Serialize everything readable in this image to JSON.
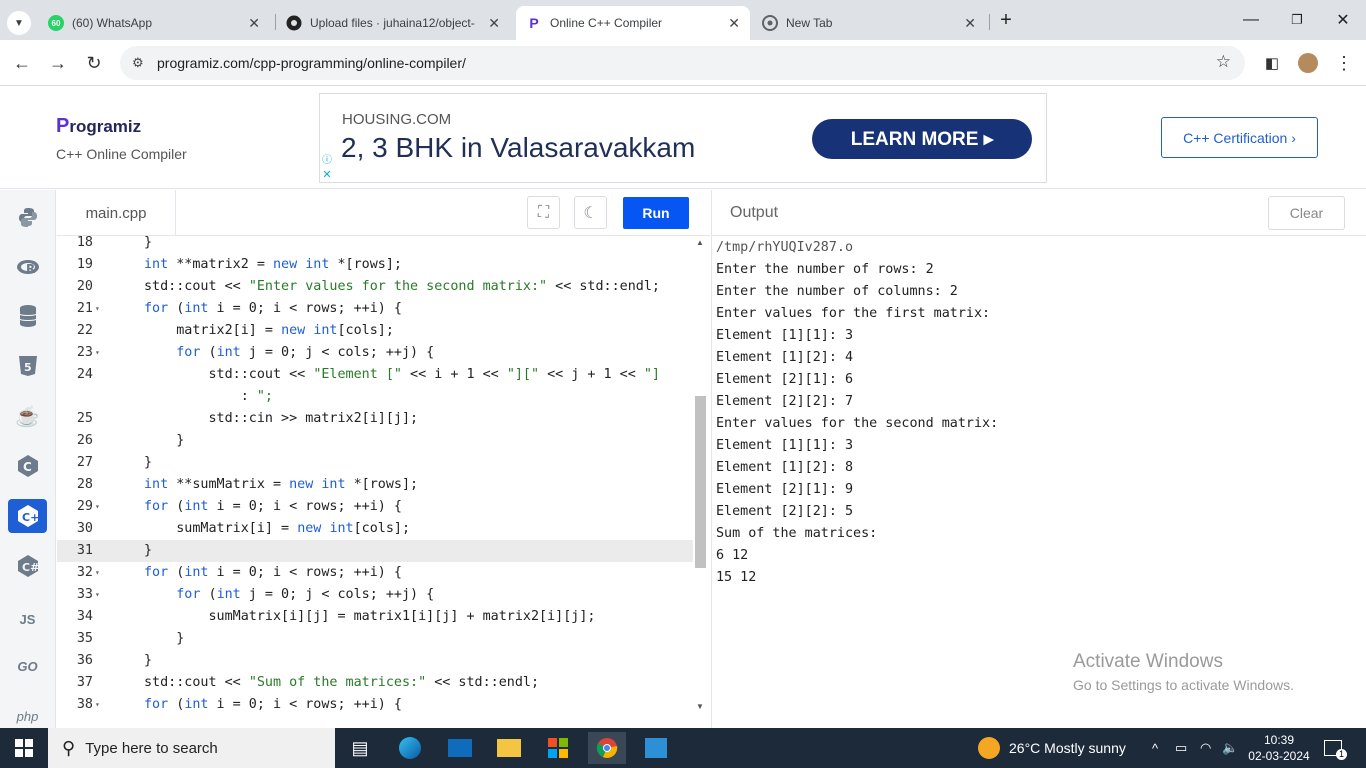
{
  "browser": {
    "tabs": [
      {
        "title": "(60) WhatsApp",
        "badge": "60"
      },
      {
        "title": "Upload files · juhaina12/object-"
      },
      {
        "title": "Online C++ Compiler"
      },
      {
        "title": "New Tab"
      }
    ],
    "url": "programiz.com/cpp-programming/online-compiler/"
  },
  "site": {
    "logo": "rogramiz",
    "logo_p": "P",
    "subtitle": "C++ Online Compiler",
    "ad": {
      "brand": "HOUSING.COM",
      "headline": "2, 3 BHK in Valasaravakkam",
      "cta": "LEARN MORE ▸"
    },
    "cert_button": "C++ Certification ›"
  },
  "rail": [
    "python",
    "r",
    "sql",
    "html5",
    "java",
    "c",
    "cpp",
    "csharp",
    "JS",
    "GO",
    "php"
  ],
  "editor": {
    "file_tab": "main.cpp",
    "run_label": "Run",
    "highlight_line": "31",
    "lines": [
      {
        "n": "18",
        "fold": "",
        "code": "}"
      },
      {
        "n": "19",
        "fold": "",
        "code": "int **matrix2 = new int *[rows];"
      },
      {
        "n": "20",
        "fold": "",
        "code": "std::cout << \"Enter values for the second matrix:\" << std::endl;"
      },
      {
        "n": "21",
        "fold": "▾",
        "code": "for (int i = 0; i < rows; ++i) {"
      },
      {
        "n": "22",
        "fold": "",
        "code": "    matrix2[i] = new int[cols];"
      },
      {
        "n": "23",
        "fold": "▾",
        "code": "    for (int j = 0; j < cols; ++j) {"
      },
      {
        "n": "24",
        "fold": "",
        "code": "        std::cout << \"Element [\" << i + 1 << \"][\" << j + 1 << \"]"
      },
      {
        "n": "",
        "fold": "",
        "code": "            : \";"
      },
      {
        "n": "25",
        "fold": "",
        "code": "        std::cin >> matrix2[i][j];"
      },
      {
        "n": "26",
        "fold": "",
        "code": "    }"
      },
      {
        "n": "27",
        "fold": "",
        "code": "}"
      },
      {
        "n": "28",
        "fold": "",
        "code": "int **sumMatrix = new int *[rows];"
      },
      {
        "n": "29",
        "fold": "▾",
        "code": "for (int i = 0; i < rows; ++i) {"
      },
      {
        "n": "30",
        "fold": "",
        "code": "    sumMatrix[i] = new int[cols];"
      },
      {
        "n": "31",
        "fold": "",
        "code": "}"
      },
      {
        "n": "32",
        "fold": "▾",
        "code": "for (int i = 0; i < rows; ++i) {"
      },
      {
        "n": "33",
        "fold": "▾",
        "code": "    for (int j = 0; j < cols; ++j) {"
      },
      {
        "n": "34",
        "fold": "",
        "code": "        sumMatrix[i][j] = matrix1[i][j] + matrix2[i][j];"
      },
      {
        "n": "35",
        "fold": "",
        "code": "    }"
      },
      {
        "n": "36",
        "fold": "",
        "code": "}"
      },
      {
        "n": "37",
        "fold": "",
        "code": "std::cout << \"Sum of the matrices:\" << std::endl;"
      },
      {
        "n": "38",
        "fold": "▾",
        "code": "for (int i = 0; i < rows; ++i) {"
      }
    ]
  },
  "output": {
    "title": "Output",
    "clear_label": "Clear",
    "lines": [
      "/tmp/rhYUQIv287.o",
      "Enter the number of rows: 2",
      "Enter the number of columns: 2",
      "Enter values for the first matrix:",
      "Element [1][1]: 3",
      "Element [1][2]: 4",
      "Element [2][1]: 6",
      "Element [2][2]: 7",
      "Enter values for the second matrix:",
      "Element [1][1]: 3",
      "Element [1][2]: 8",
      "Element [2][1]: 9",
      "Element [2][2]: 5",
      "Sum of the matrices:",
      "6 12",
      "15 12"
    ]
  },
  "watermark": {
    "line1": "Activate Windows",
    "line2": "Go to Settings to activate Windows."
  },
  "taskbar": {
    "search_placeholder": "Type here to search",
    "weather": "26°C  Mostly sunny",
    "time": "10:39",
    "date": "02-03-2024",
    "notification_count": "1"
  },
  "colors": {
    "accent": "#0556f3",
    "brand": "#25265e",
    "taskbar": "#1c2a3a"
  }
}
